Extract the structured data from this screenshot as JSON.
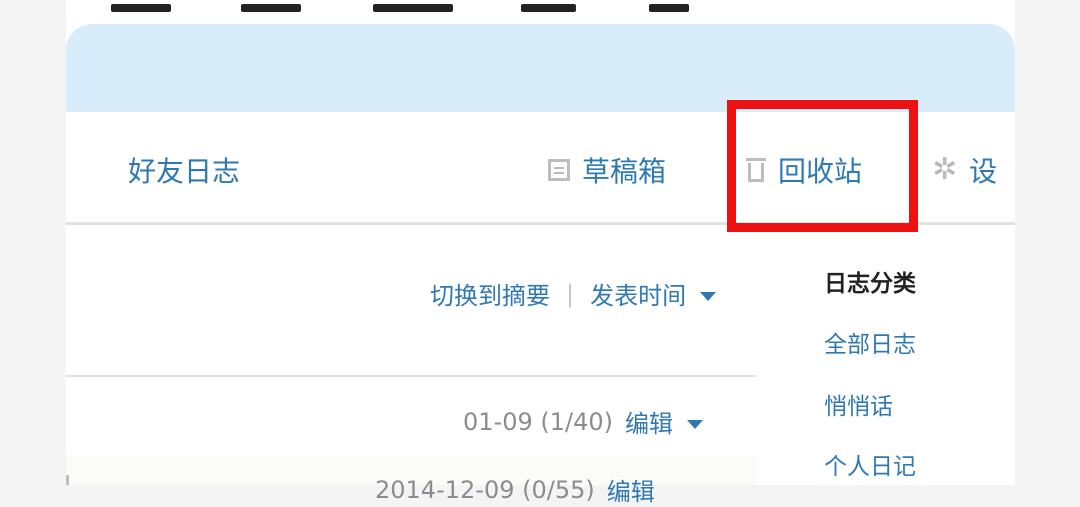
{
  "tabs": {
    "friends_journal": "好友日志"
  },
  "toolbar": {
    "drafts_label": "草稿箱",
    "trash_label": "回收站",
    "settings_label_partial": "设"
  },
  "icons": {
    "drafts": "drafts-icon",
    "trash": "trash-icon",
    "settings": "gear-icon"
  },
  "sort": {
    "toggle_summary": "切换到摘要",
    "separator": "|",
    "sort_by": "发表时间"
  },
  "entries": [
    {
      "meta": "01-09 (1/40)",
      "action": "编辑"
    },
    {
      "meta": "2014-12-09 (0/55)",
      "action": "编辑"
    }
  ],
  "sidebar": {
    "title": "日志分类",
    "items": [
      {
        "label": "全部日志"
      },
      {
        "label": "悄悄话"
      },
      {
        "label": "个人日记"
      }
    ]
  },
  "highlight_color": "#ee1111",
  "link_color": "#2f79b3"
}
